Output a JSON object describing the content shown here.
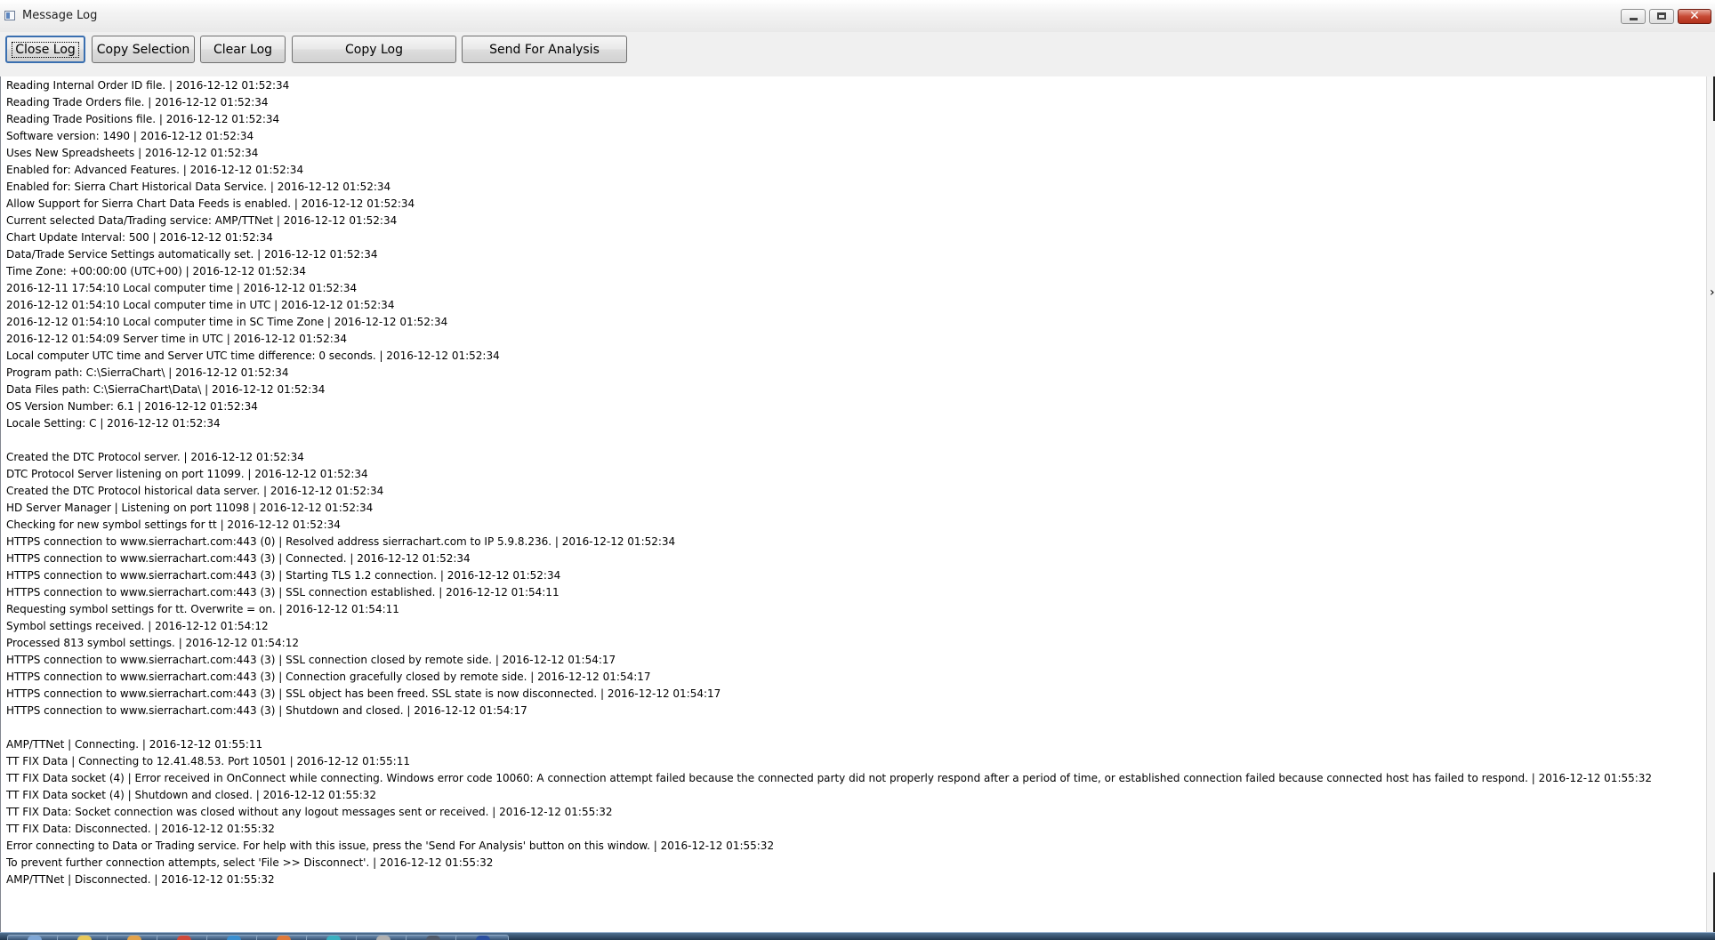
{
  "window": {
    "title": "Message Log",
    "close_glyph": "✕"
  },
  "toolbar": {
    "close_log": "Close Log",
    "copy_selection": "Copy Selection",
    "clear_log": "Clear Log",
    "copy_log": "Copy Log",
    "send_for_analysis": "Send For Analysis"
  },
  "log": {
    "lines": [
      "Reading Internal Order ID file. | 2016-12-12  01:52:34",
      "Reading Trade Orders file. | 2016-12-12  01:52:34",
      "Reading Trade Positions file. | 2016-12-12  01:52:34",
      "Software version: 1490 | 2016-12-12  01:52:34",
      "Uses New Spreadsheets | 2016-12-12  01:52:34",
      "Enabled for: Advanced Features. | 2016-12-12  01:52:34",
      "Enabled for: Sierra Chart Historical Data Service. | 2016-12-12  01:52:34",
      "Allow Support for Sierra Chart Data Feeds is enabled. | 2016-12-12  01:52:34",
      "Current selected Data/Trading service: AMP/TTNet | 2016-12-12  01:52:34",
      "Chart Update Interval: 500 | 2016-12-12  01:52:34",
      "Data/Trade Service Settings automatically set. | 2016-12-12  01:52:34",
      "Time Zone: +00:00:00 (UTC+00) | 2016-12-12  01:52:34",
      "2016-12-11  17:54:10  Local computer time | 2016-12-12  01:52:34",
      "2016-12-12  01:54:10  Local computer time in UTC | 2016-12-12  01:52:34",
      "2016-12-12  01:54:10  Local computer time in SC Time Zone | 2016-12-12  01:52:34",
      "2016-12-12  01:54:09  Server time in UTC | 2016-12-12  01:52:34",
      "Local computer UTC time and Server UTC time difference: 0 seconds. | 2016-12-12  01:52:34",
      "Program path: C:\\SierraChart\\ | 2016-12-12  01:52:34",
      "Data Files path: C:\\SierraChart\\Data\\ | 2016-12-12  01:52:34",
      "OS Version Number: 6.1 | 2016-12-12  01:52:34",
      "Locale Setting: C | 2016-12-12  01:52:34",
      "",
      "Created the DTC Protocol server. | 2016-12-12  01:52:34",
      "DTC Protocol Server listening on port 11099. | 2016-12-12  01:52:34",
      "Created the DTC Protocol historical data server. | 2016-12-12  01:52:34",
      "HD Server Manager | Listening on port 11098 | 2016-12-12  01:52:34",
      "Checking for new symbol settings for tt | 2016-12-12  01:52:34",
      "HTTPS connection to www.sierrachart.com:443 (0) | Resolved address sierrachart.com to IP 5.9.8.236. | 2016-12-12  01:52:34",
      "HTTPS connection to www.sierrachart.com:443 (3) | Connected. | 2016-12-12  01:52:34",
      "HTTPS connection to www.sierrachart.com:443 (3) | Starting TLS 1.2 connection. | 2016-12-12  01:52:34",
      "HTTPS connection to www.sierrachart.com:443 (3) | SSL connection established. | 2016-12-12  01:54:11",
      "Requesting symbol settings for tt.  Overwrite = on. | 2016-12-12  01:54:11",
      "Symbol settings received. | 2016-12-12  01:54:12",
      "Processed 813 symbol settings. | 2016-12-12  01:54:12",
      "HTTPS connection to www.sierrachart.com:443 (3) | SSL connection closed by remote side. | 2016-12-12  01:54:17",
      "HTTPS connection to www.sierrachart.com:443 (3) | Connection gracefully closed by remote side. | 2016-12-12  01:54:17",
      "HTTPS connection to www.sierrachart.com:443 (3) | SSL object has been freed.  SSL state is now disconnected. | 2016-12-12  01:54:17",
      "HTTPS connection to www.sierrachart.com:443 (3) | Shutdown and closed. | 2016-12-12  01:54:17",
      "",
      "AMP/TTNet | Connecting. | 2016-12-12  01:55:11",
      "TT FIX Data | Connecting to 12.41.48.53. Port 10501 | 2016-12-12  01:55:11",
      "TT FIX Data socket (4) | Error received in OnConnect while connecting.   Windows error code 10060: A connection attempt failed because the connected party did not properly respond after a period of time, or established connection failed because connected host has failed to respond. | 2016-12-12  01:55:32",
      "TT FIX Data socket (4) | Shutdown and closed. | 2016-12-12  01:55:32",
      "TT FIX Data: Socket connection was closed without any logout messages sent or received. | 2016-12-12  01:55:32",
      "TT FIX Data: Disconnected. | 2016-12-12  01:55:32",
      "Error connecting to Data or Trading service.  For help with this issue, press the 'Send For Analysis' button on this window.  | 2016-12-12  01:55:32",
      "To prevent further connection attempts, select 'File >> Disconnect'. | 2016-12-12  01:55:32",
      "AMP/TTNet | Disconnected. | 2016-12-12  01:55:32"
    ]
  },
  "taskbar": {
    "items": [
      {
        "icon": "start-orb-icon",
        "color": "#7fa7d6"
      },
      {
        "icon": "folder-icon",
        "color": "#e8c85a"
      },
      {
        "icon": "browser-icon",
        "color": "#e2a24a"
      },
      {
        "icon": "app-red-icon",
        "color": "#d04a3a"
      },
      {
        "icon": "app-blue-icon",
        "color": "#3a8fd0"
      },
      {
        "icon": "app-orange-icon",
        "color": "#e07a3a"
      },
      {
        "icon": "app-teal-icon",
        "color": "#3ab0c0"
      },
      {
        "icon": "app-gray-icon",
        "color": "#b0b0b0"
      },
      {
        "icon": "app-dark-icon",
        "color": "#505a6a"
      },
      {
        "icon": "app-globe-icon",
        "color": "#2a4fa0"
      }
    ]
  }
}
